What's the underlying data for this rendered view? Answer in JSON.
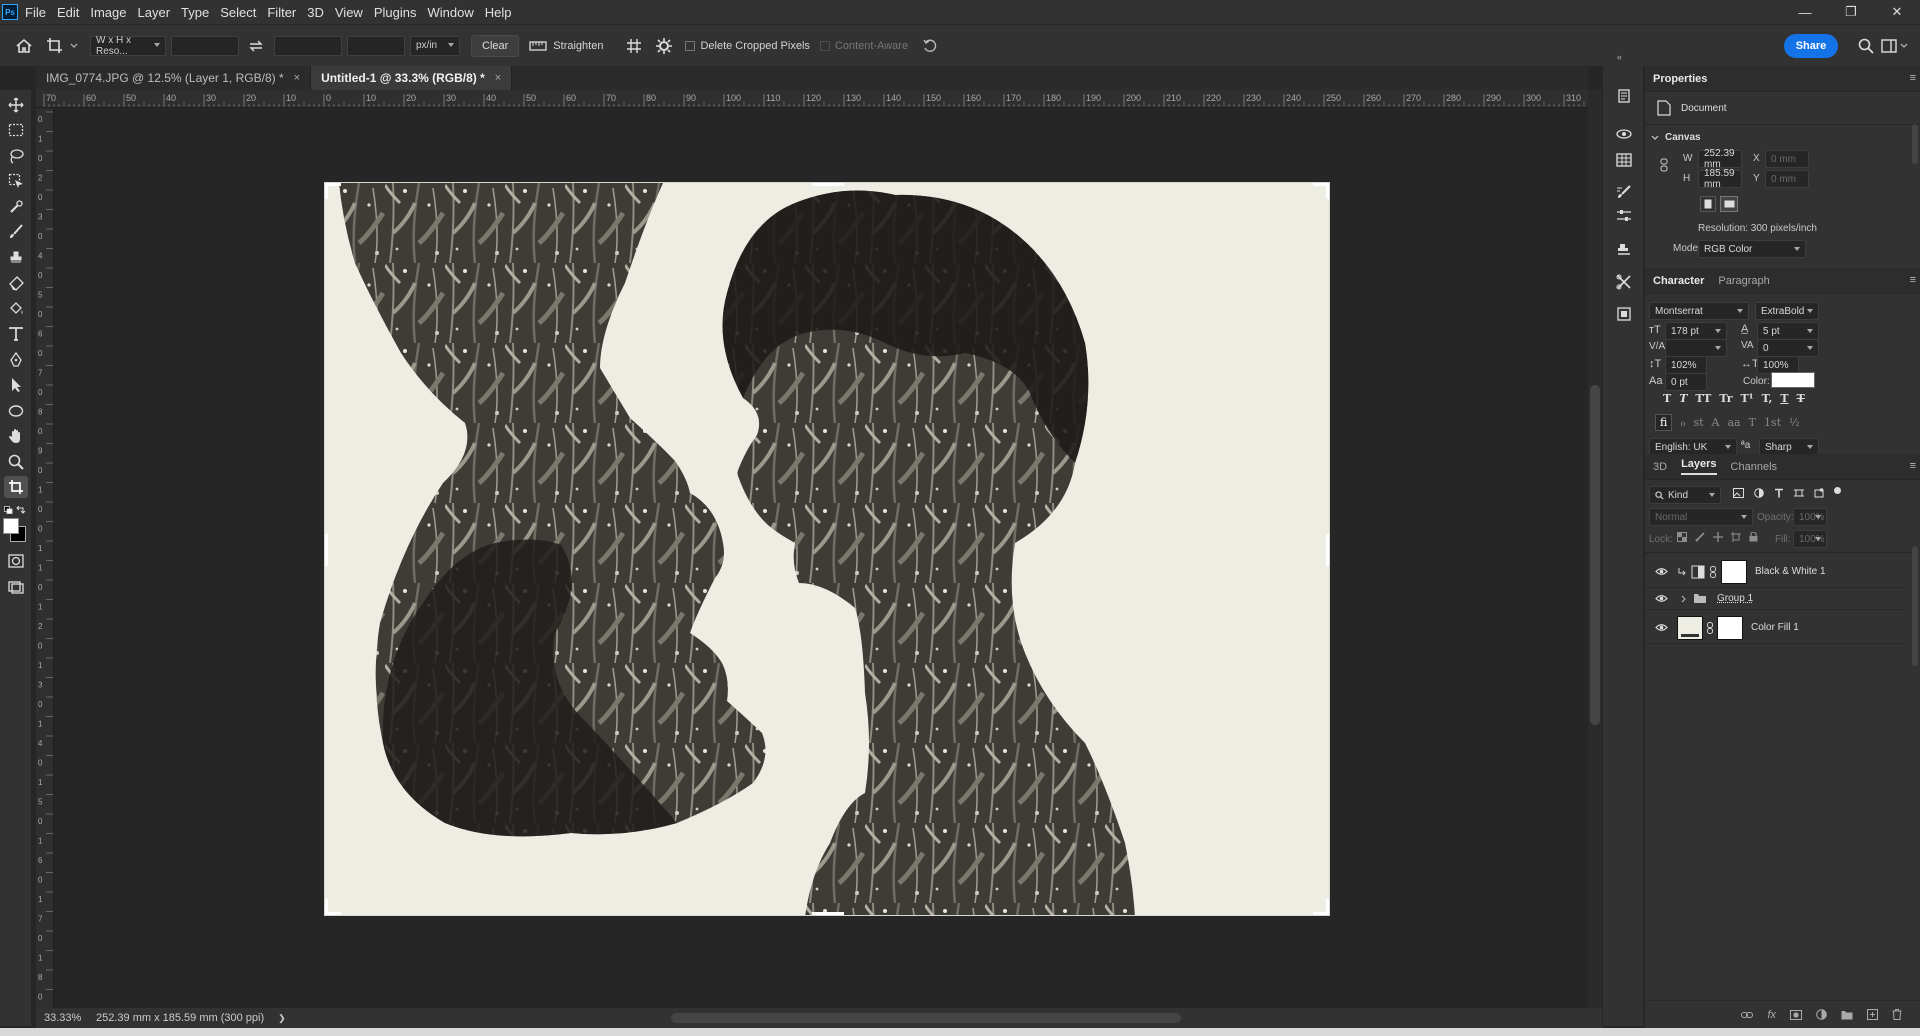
{
  "menubar": {
    "logo": "Ps",
    "items": [
      "File",
      "Edit",
      "Image",
      "Layer",
      "Type",
      "Select",
      "Filter",
      "3D",
      "View",
      "Plugins",
      "Window",
      "Help"
    ]
  },
  "window_controls": {
    "minimize": "—",
    "restore": "❐",
    "close": "✕"
  },
  "options_bar": {
    "ratio_select": "W x H x Reso...",
    "unit_select": "px/in",
    "clear_label": "Clear",
    "straighten_label": "Straighten",
    "delete_cropped_label": "Delete Cropped Pixels",
    "content_aware_label": "Content-Aware",
    "share_label": "Share"
  },
  "doc_tabs": [
    {
      "label": "IMG_0774.JPG @ 12.5% (Layer 1, RGB/8) *",
      "close": "×",
      "active": false
    },
    {
      "label": "Untitled-1 @ 33.3% (RGB/8) *",
      "close": "×",
      "active": true
    }
  ],
  "ruler_top_labels": [
    "70",
    "60",
    "50",
    "40",
    "30",
    "20",
    "10",
    "0",
    "10",
    "20",
    "30",
    "40",
    "50",
    "60",
    "70",
    "80",
    "90",
    "100",
    "110",
    "120",
    "130",
    "140",
    "150",
    "160",
    "170",
    "180",
    "190",
    "200",
    "210",
    "220",
    "230",
    "240",
    "250",
    "260",
    "270",
    "280",
    "290",
    "300",
    "310"
  ],
  "ruler_left_labels": [
    "0",
    "1",
    "0",
    "2",
    "0",
    "3",
    "0",
    "4",
    "0",
    "5",
    "0",
    "6",
    "0",
    "7",
    "0",
    "8",
    "0",
    "9",
    "0",
    "1",
    "0",
    "0",
    "1",
    "1",
    "0",
    "1",
    "2",
    "0",
    "1",
    "3",
    "0",
    "1",
    "4",
    "0",
    "1",
    "5",
    "0",
    "1",
    "6",
    "0",
    "1",
    "7",
    "0",
    "1",
    "8",
    "0"
  ],
  "status": {
    "zoom": "33.33%",
    "doc_info": "252.39 mm x 185.59 mm (300 ppi)",
    "arrow": "❯"
  },
  "properties": {
    "tab": "Properties",
    "doc_label": "Document",
    "canvas_label": "Canvas",
    "w_label": "W",
    "w_value": "252.39 mm",
    "h_label": "H",
    "h_value": "185.59 mm",
    "x_label": "X",
    "x_value": "0 mm",
    "y_label": "Y",
    "y_value": "0 mm",
    "resolution": "Resolution: 300 pixels/inch",
    "mode_label": "Mode",
    "mode_value": "RGB Color"
  },
  "character": {
    "tabs": [
      "Character",
      "Paragraph"
    ],
    "font_family": "Montserrat",
    "font_style": "ExtraBold",
    "font_size": "178 pt",
    "leading": "5 pt",
    "kerning": "",
    "tracking": "0",
    "vertical_scale": "102%",
    "horizontal_scale": "100%",
    "baseline_shift": "0 pt",
    "color_label": "Color:",
    "language": "English: UK",
    "antialias": "Sharp",
    "glyph_style_1": [
      "T",
      "T",
      "TT",
      "Tr",
      "T¹",
      "T,",
      "T",
      "T"
    ],
    "glyph_style_2": [
      "fi",
      "ℴ",
      "st",
      "A",
      "aa",
      "T",
      "1st",
      "½"
    ]
  },
  "layers": {
    "tabs": [
      "3D",
      "Layers",
      "Channels"
    ],
    "filter_kind": "Kind",
    "blend_mode": "Normal",
    "opacity_label": "Opacity:",
    "opacity_value": "100%",
    "lock_label": "Lock:",
    "fill_label": "Fill:",
    "fill_value": "100%",
    "items": [
      {
        "name": "Black & White 1",
        "type": "adjustment"
      },
      {
        "name": "Group 1",
        "type": "group"
      },
      {
        "name": "Color Fill 1",
        "type": "fill"
      }
    ],
    "footer_icons": [
      "link-icon",
      "fx-icon",
      "mask-icon",
      "adjustment-icon",
      "folder-icon",
      "new-layer-icon",
      "trash-icon"
    ]
  },
  "colors": {
    "accent": "#1473e6",
    "bg": "#262626",
    "panel": "#323232",
    "canvas_bg": "#eeede4"
  }
}
